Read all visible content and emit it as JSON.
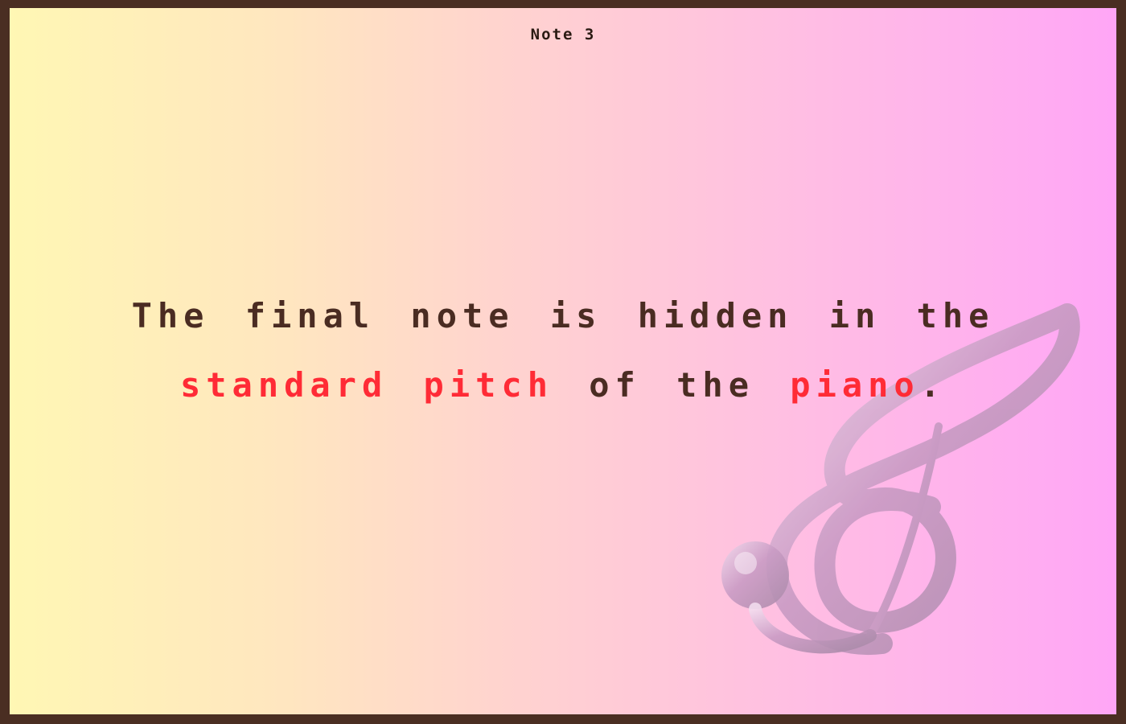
{
  "note": {
    "title": "Note 3"
  },
  "message": {
    "line1": "The final note is hidden in the",
    "line2_part1": "standard pitch",
    "line2_part2": " of the ",
    "line2_part3": "piano",
    "line2_part4": "."
  },
  "colors": {
    "border": "#4a2e22",
    "text": "#4a2c22",
    "highlight": "#ff2b36",
    "gradient_left": "#fff7b4",
    "gradient_right": "#ffa6f6"
  },
  "icons": {
    "clef": "treble-clef-icon"
  }
}
